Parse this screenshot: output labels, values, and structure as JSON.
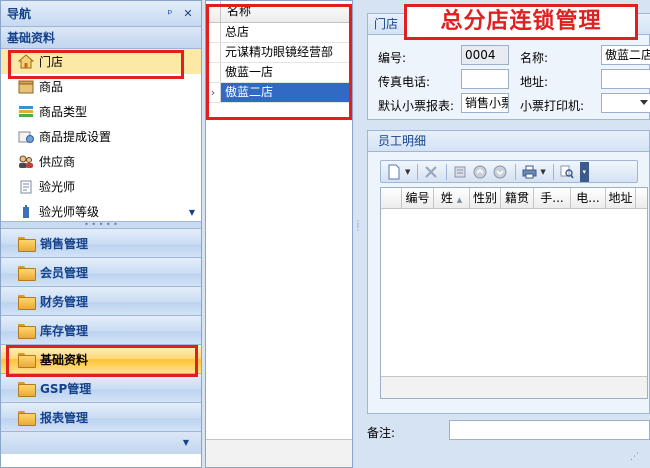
{
  "nav": {
    "title": "导航",
    "pin_symbol": "ᵖ",
    "close_symbol": "✕",
    "subheader": "基础资料",
    "items": [
      {
        "label": "门店",
        "icon": "home-icon"
      },
      {
        "label": "商品",
        "icon": "goods-icon"
      },
      {
        "label": "商品类型",
        "icon": "product-type-icon"
      },
      {
        "label": "商品提成设置",
        "icon": "commission-icon"
      },
      {
        "label": "供应商",
        "icon": "supplier-icon"
      },
      {
        "label": "验光师",
        "icon": "optometrist-icon"
      },
      {
        "label": "验光师等级",
        "icon": "optometrist-level-icon"
      }
    ],
    "groups": [
      {
        "label": "销售管理"
      },
      {
        "label": "会员管理"
      },
      {
        "label": "财务管理"
      },
      {
        "label": "库存管理"
      },
      {
        "label": "基础资料"
      },
      {
        "label": "GSP管理"
      },
      {
        "label": "报表管理"
      }
    ]
  },
  "store_list": {
    "column_header": "名称",
    "rows": [
      {
        "name": "总店"
      },
      {
        "name": "元谋精功眼镜经营部"
      },
      {
        "name": "傲蓝一店"
      },
      {
        "name": "傲蓝二店"
      }
    ]
  },
  "store_form": {
    "group_title": "门店",
    "banner": "总分店连锁管理",
    "code_label": "编号:",
    "code_value": "0004",
    "name_label": "名称:",
    "name_value": "傲蓝二店",
    "fax_label": "传真电话:",
    "fax_value": "",
    "address_label": "地址:",
    "address_value": "",
    "receipt_report_label": "默认小票报表:",
    "receipt_report_value": "销售小票",
    "receipt_printer_label": "小票打印机:",
    "receipt_printer_value": ""
  },
  "employees": {
    "group_title": "员工明细",
    "columns": [
      "编号",
      "姓",
      "性别",
      "籍贯",
      "手...",
      "电...",
      "地址"
    ]
  },
  "remark": {
    "label": "备注:",
    "value": ""
  },
  "colors": {
    "highlight": "#e02020",
    "selection": "#316ac5",
    "nav_active": "#ffc234"
  }
}
